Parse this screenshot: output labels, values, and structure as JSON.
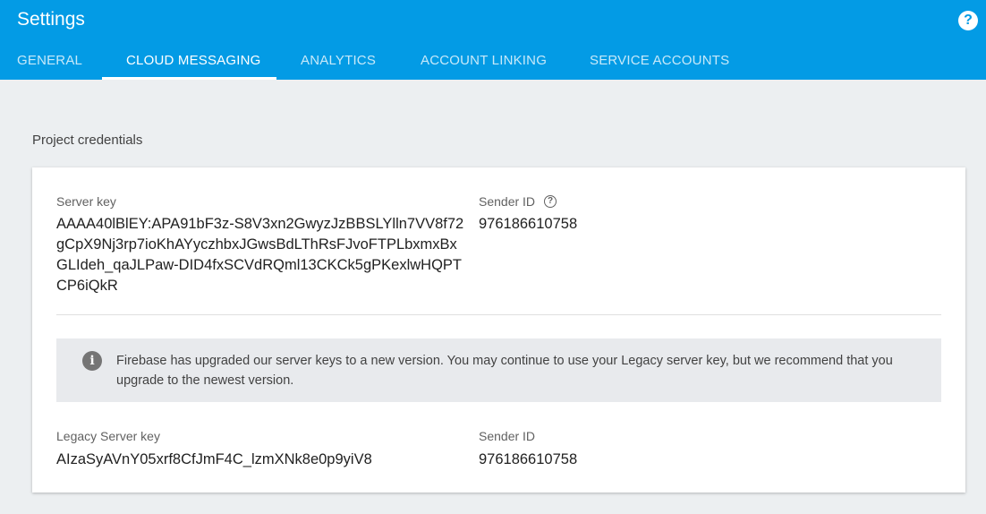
{
  "header": {
    "title": "Settings",
    "help_icon": "help-icon",
    "tabs": [
      {
        "label": "GENERAL",
        "active": false
      },
      {
        "label": "CLOUD MESSAGING",
        "active": true
      },
      {
        "label": "ANALYTICS",
        "active": false
      },
      {
        "label": "ACCOUNT LINKING",
        "active": false
      },
      {
        "label": "SERVICE ACCOUNTS",
        "active": false
      }
    ]
  },
  "section": {
    "label": "Project credentials"
  },
  "credentials": {
    "server_key_label": "Server key",
    "server_key_value": "AAAA40lBlEY:APA91bF3z-S8V3xn2GwyzJzBBSLYlln7VV8f72gCpX9Nj3rp7ioKhAYyczhbxJGwsBdLThRsFJvoFTPLbxmxBxGLIdeh_qaJLPaw-DID4fxSCVdRQml13CKCk5gPKexlwHQPTCP6iQkR",
    "sender_id_label": "Sender ID",
    "sender_id_value": "976186610758",
    "notice_text": "Firebase has upgraded our server keys to a new version. You may continue to use your Legacy server key, but we recommend that you upgrade to the newest version.",
    "legacy_key_label": "Legacy Server key",
    "legacy_key_value": "AIzaSyAVnY05xrf8CfJmF4C_lzmXNk8e0p9yiV8",
    "legacy_sender_id_label": "Sender ID",
    "legacy_sender_id_value": "976186610758"
  },
  "colors": {
    "header": "#039be5",
    "background": "#eceff1",
    "card": "#ffffff"
  }
}
